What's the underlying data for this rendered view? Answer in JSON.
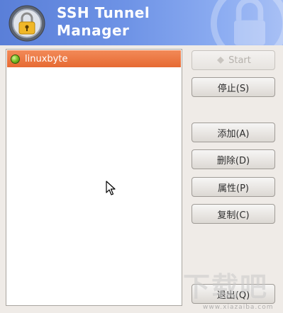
{
  "header": {
    "title_line1": "SSH Tunnel",
    "title_line2": "Manager",
    "accent": "#6e93e6"
  },
  "tunnels": [
    {
      "name": "linuxbyte",
      "status": "active",
      "status_color": "#7fc128"
    }
  ],
  "buttons": {
    "start": "Start",
    "stop": "停止(S)",
    "add": "添加(A)",
    "delete": "删除(D)",
    "properties": "属性(P)",
    "copy": "复制(C)",
    "quit": "退出(Q)"
  },
  "watermark": {
    "text": "下载吧",
    "url": "www.xiazaiba.com"
  },
  "colors": {
    "selection": "#e66a33",
    "window_bg": "#efebe7"
  }
}
